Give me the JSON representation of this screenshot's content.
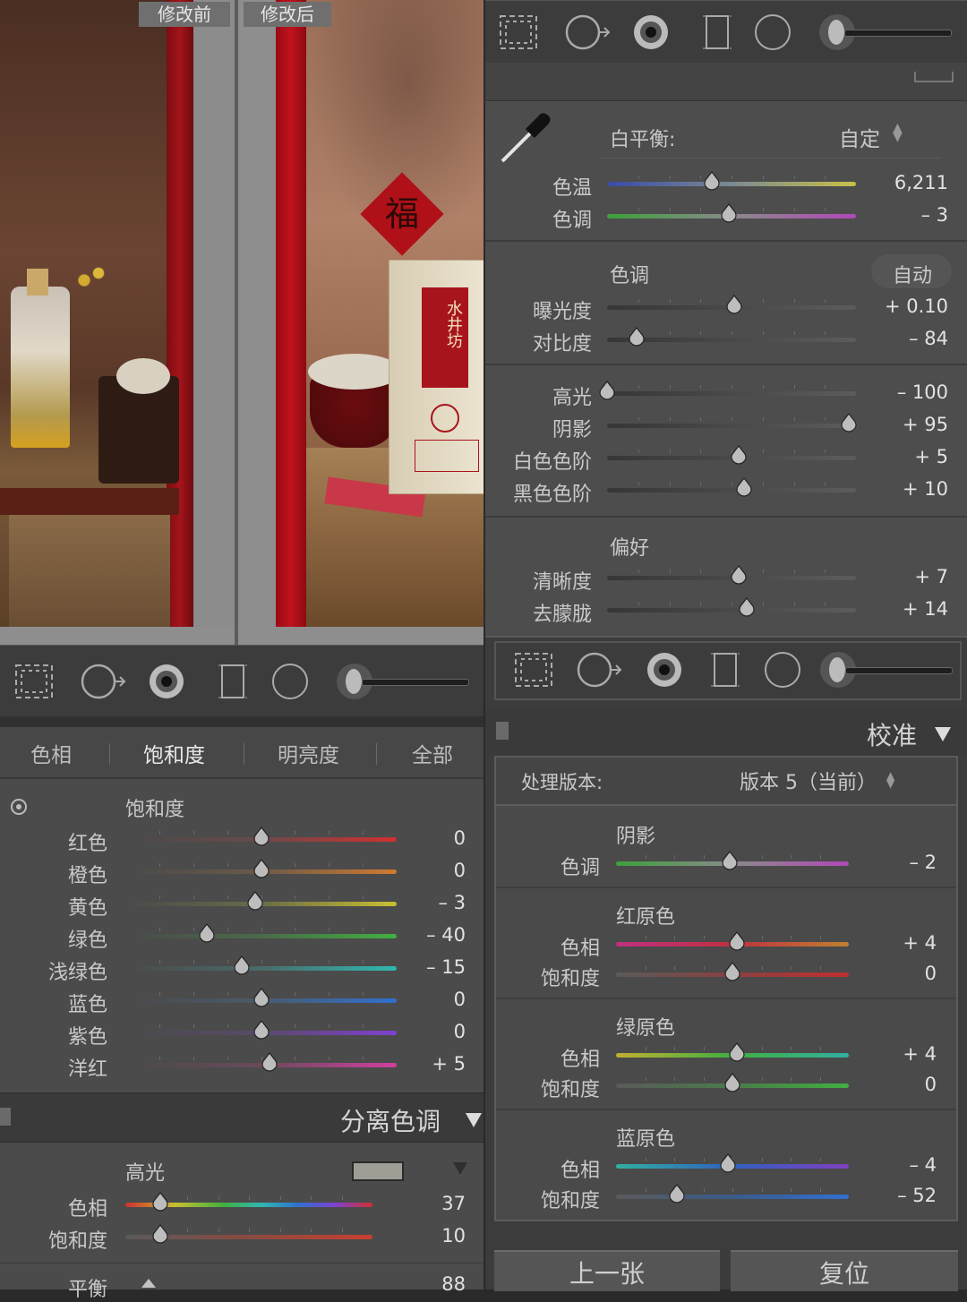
{
  "photo": {
    "before_label": "修改前",
    "after_label": "修改后",
    "fu_char": "福",
    "brand_text": "水井坊"
  },
  "toolbars": {
    "icons": [
      "crop-icon",
      "spot-removal-icon",
      "red-eye-icon",
      "graduated-filter-icon",
      "radial-filter-icon",
      "adjustment-brush-icon"
    ]
  },
  "basic": {
    "wb_label": "白平衡:",
    "wb_value": "自定",
    "temp": {
      "label": "色温",
      "value": "6,211",
      "pos": 0.42
    },
    "tint": {
      "label": "色调",
      "value": "– 3",
      "pos": 0.49
    },
    "tone_header": "色调",
    "auto_label": "自动",
    "exposure": {
      "label": "曝光度",
      "value": "+ 0.10",
      "pos": 0.51
    },
    "contrast": {
      "label": "对比度",
      "value": "– 84",
      "pos": 0.12
    },
    "highlights": {
      "label": "高光",
      "value": "– 100",
      "pos": 0.0
    },
    "shadows": {
      "label": "阴影",
      "value": "+ 95",
      "pos": 0.97
    },
    "whites": {
      "label": "白色色阶",
      "value": "+ 5",
      "pos": 0.53
    },
    "blacks": {
      "label": "黑色色阶",
      "value": "+ 10",
      "pos": 0.55
    },
    "presence_header": "偏好",
    "clarity": {
      "label": "清晰度",
      "value": "+ 7",
      "pos": 0.53
    },
    "dehaze": {
      "label": "去朦胧",
      "value": "+ 14",
      "pos": 0.56
    }
  },
  "hsl": {
    "tabs": [
      "色相",
      "饱和度",
      "明亮度",
      "全部"
    ],
    "header": "饱和度",
    "rows": [
      {
        "label": "红色",
        "value": "0",
        "pos": 0.5
      },
      {
        "label": "橙色",
        "value": "0",
        "pos": 0.5
      },
      {
        "label": "黄色",
        "value": "– 3",
        "pos": 0.48
      },
      {
        "label": "绿色",
        "value": "– 40",
        "pos": 0.3
      },
      {
        "label": "浅绿色",
        "value": "– 15",
        "pos": 0.43
      },
      {
        "label": "蓝色",
        "value": "0",
        "pos": 0.5
      },
      {
        "label": "紫色",
        "value": "0",
        "pos": 0.5
      },
      {
        "label": "洋红",
        "value": "+ 5",
        "pos": 0.53
      }
    ]
  },
  "split": {
    "title": "分离色调",
    "header": "高光",
    "swatch": "#9f9e95",
    "hue": {
      "label": "色相",
      "value": "37",
      "pos": 0.14
    },
    "sat": {
      "label": "饱和度",
      "value": "10",
      "pos": 0.14
    },
    "balance_label": "平衡",
    "balance_value": "88"
  },
  "calibration": {
    "title": "校准",
    "process_label": "处理版本:",
    "process_value": "版本 5（当前）",
    "shadows_header": "阴影",
    "shadow_tint": {
      "label": "色调",
      "value": "– 2",
      "pos": 0.49
    },
    "red_header": "红原色",
    "red_hue": {
      "label": "色相",
      "value": "+ 4",
      "pos": 0.52
    },
    "red_sat": {
      "label": "饱和度",
      "value": "0",
      "pos": 0.5
    },
    "green_header": "绿原色",
    "green_hue": {
      "label": "色相",
      "value": "+ 4",
      "pos": 0.52
    },
    "green_sat": {
      "label": "饱和度",
      "value": "0",
      "pos": 0.5
    },
    "blue_header": "蓝原色",
    "blue_hue": {
      "label": "色相",
      "value": "– 4",
      "pos": 0.48
    },
    "blue_sat": {
      "label": "饱和度",
      "value": "– 52",
      "pos": 0.26
    }
  },
  "buttons": {
    "prev": "上一张",
    "reset": "复位"
  }
}
